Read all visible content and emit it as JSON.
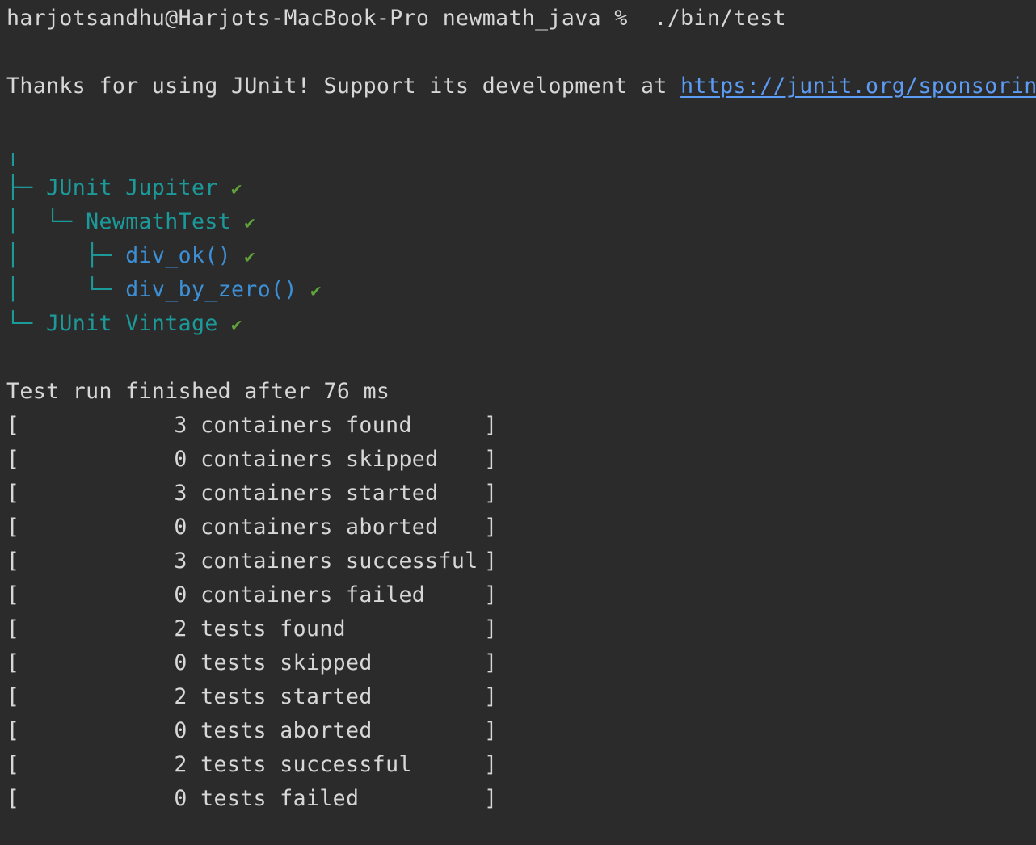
{
  "prompt": {
    "user_host": "harjotsandhu@Harjots-MacBook-Pro",
    "directory": "newmath_java",
    "symbol": "%",
    "command": "./bin/test"
  },
  "banner": {
    "text": "Thanks for using JUnit! Support its development at ",
    "link": "https://junit.org/sponsoring"
  },
  "tree": {
    "root_glyph": "╷",
    "check_mark": "✔",
    "nodes": [
      {
        "prefix": "├─ ",
        "label": "JUnit Jupiter",
        "kind": "engine"
      },
      {
        "prefix": "│  └─ ",
        "label": "NewmathTest",
        "kind": "class"
      },
      {
        "prefix": "│     ├─ ",
        "label": "div_ok()",
        "kind": "test"
      },
      {
        "prefix": "│     └─ ",
        "label": "div_by_zero()",
        "kind": "test"
      },
      {
        "prefix": "└─ ",
        "label": "JUnit Vintage",
        "kind": "engine"
      }
    ]
  },
  "summary": {
    "title": "Test run finished after 76 ms",
    "open_bracket": "[",
    "close_bracket": "]",
    "rows": [
      {
        "count": "3",
        "label": "containers found"
      },
      {
        "count": "0",
        "label": "containers skipped"
      },
      {
        "count": "3",
        "label": "containers started"
      },
      {
        "count": "0",
        "label": "containers aborted"
      },
      {
        "count": "3",
        "label": "containers successful"
      },
      {
        "count": "0",
        "label": "containers failed"
      },
      {
        "count": "2",
        "label": "tests found"
      },
      {
        "count": "0",
        "label": "tests skipped"
      },
      {
        "count": "2",
        "label": "tests started"
      },
      {
        "count": "0",
        "label": "tests aborted"
      },
      {
        "count": "2",
        "label": "tests successful"
      },
      {
        "count": "0",
        "label": "tests failed"
      }
    ]
  },
  "colors": {
    "background": "#2b2b2b",
    "foreground": "#d7d7d7",
    "tree_cyan": "#1c9a9a",
    "test_blue": "#3d8fd6",
    "check_green": "#5fa33a",
    "link_blue": "#5c9cf5"
  }
}
